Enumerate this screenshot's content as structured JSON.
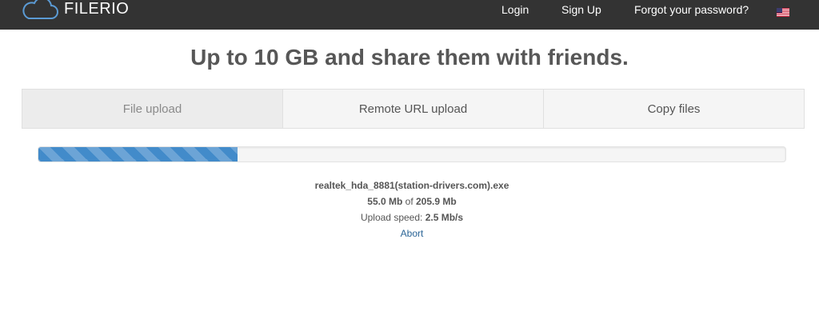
{
  "nav": {
    "brand": "FILERIO",
    "brand_icon": "cloud-icon",
    "links": [
      "Login",
      "Sign Up",
      "Forgot your password?"
    ],
    "language_icon": "us-flag-icon"
  },
  "headline": "Up to 10 GB and share them with friends.",
  "tabs": [
    {
      "label": "File upload",
      "active": true
    },
    {
      "label": "Remote URL upload",
      "active": false
    },
    {
      "label": "Copy files",
      "active": false
    }
  ],
  "upload": {
    "progress_fraction": 0.267,
    "filename": "realtek_hda_8881(station-drivers.com).exe",
    "uploaded": "55.0 Mb",
    "of_label": "of",
    "total": "205.9 Mb",
    "speed_label": "Upload speed:",
    "speed": "2.5 Mb/s",
    "abort_label": "Abort"
  },
  "colors": {
    "navbar": "#333333",
    "progress": "#428bca",
    "link": "#2a6496"
  }
}
